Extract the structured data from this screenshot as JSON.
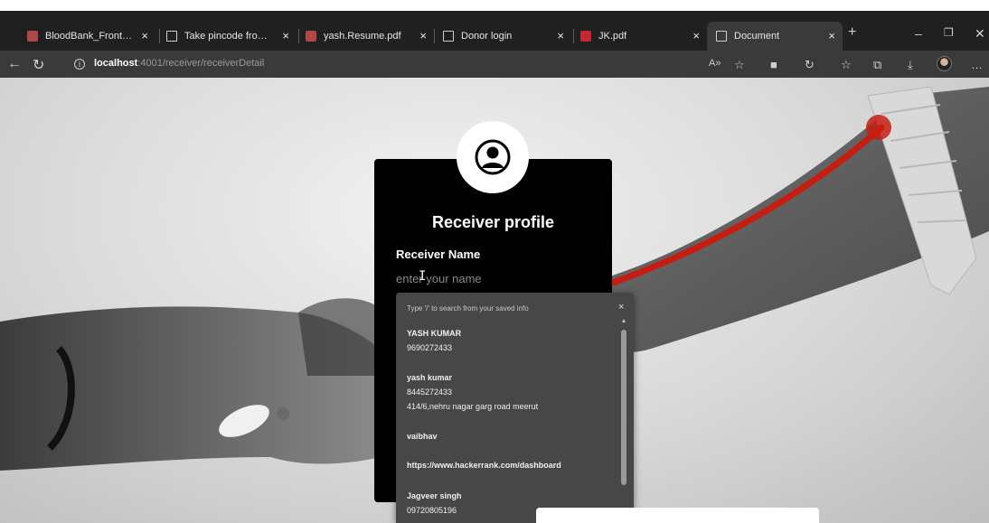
{
  "browser": {
    "tabs": [
      {
        "title": "BloodBank_Frontend",
        "icon": "site-icon"
      },
      {
        "title": "Take pincode from the",
        "icon": "doc-icon"
      },
      {
        "title": "yash.Resume.pdf",
        "icon": "site-icon"
      },
      {
        "title": "Donor login",
        "icon": "doc-icon"
      },
      {
        "title": "JK.pdf",
        "icon": "pdf-icon"
      },
      {
        "title": "Document",
        "icon": "doc-icon",
        "active": true
      }
    ],
    "tab_close_glyph": "×",
    "new_tab_glyph": "+",
    "url_host": "localhost",
    "url_path": ":4001/receiver/receiverDetail"
  },
  "card": {
    "title": "Receiver profile",
    "name_label": "Receiver Name",
    "name_placeholder": "enter your name",
    "name_value": ""
  },
  "autofill": {
    "hint": "Type '/' to search from your saved info",
    "close_glyph": "×",
    "items": [
      {
        "name": "YASH KUMAR",
        "lines": [
          "9690272433"
        ]
      },
      {
        "name": "yash kumar",
        "lines": [
          "8445272433",
          "414/6,nehru  nagar garg road meerut"
        ]
      },
      {
        "name": "vaibhav",
        "lines": []
      },
      {
        "name": "https://www.hackerrank.com/dashboard",
        "lines": []
      },
      {
        "name": "Jagveer singh",
        "lines": [
          "09720805196"
        ]
      }
    ]
  },
  "colors": {
    "chrome_bg": "#202020",
    "active_tab": "#3a3a3a",
    "card_bg": "#000000",
    "autofill_bg": "#474747",
    "blood_red": "#c61d10"
  }
}
